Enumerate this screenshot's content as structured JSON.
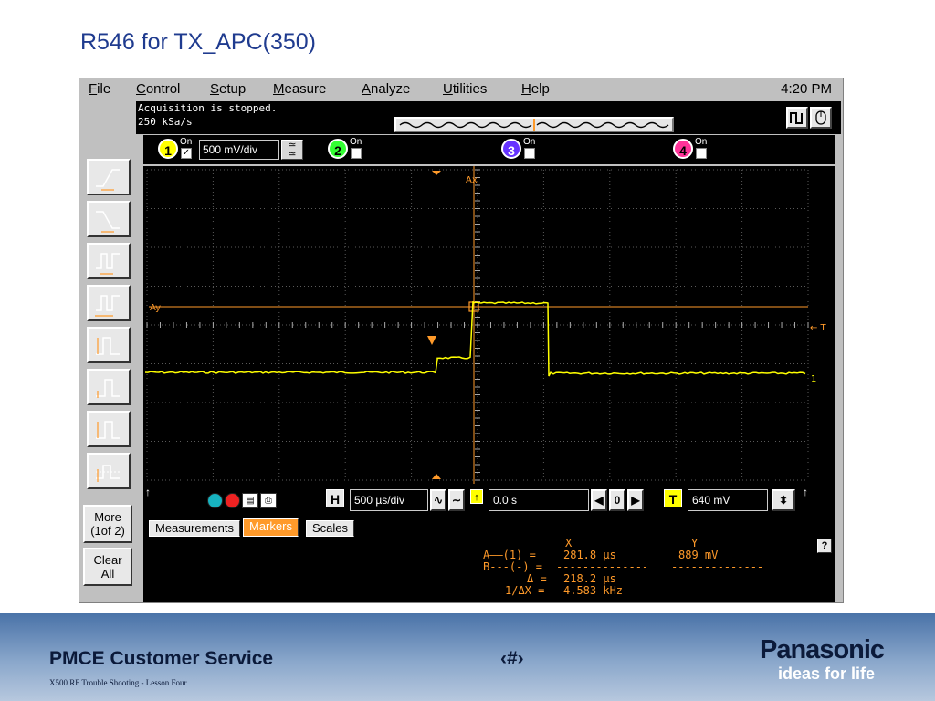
{
  "slide": {
    "title": "R546 for TX_APC(350)"
  },
  "menubar": {
    "items": [
      {
        "key": "F",
        "rest": "ile"
      },
      {
        "key": "C",
        "rest": "ontrol"
      },
      {
        "key": "S",
        "rest": "etup"
      },
      {
        "key": "M",
        "rest": "easure"
      },
      {
        "key": "A",
        "rest": "nalyze"
      },
      {
        "key": "U",
        "rest": "tilities"
      },
      {
        "key": "H",
        "rest": "elp"
      }
    ],
    "clock": "4:20 PM"
  },
  "status": {
    "line1": "Acquisition is stopped.",
    "line2": "250 kSa/s"
  },
  "channels": [
    {
      "num": "1",
      "on_label": "On",
      "checked": "✓",
      "scale": "500 mV/div",
      "color": "#ffff00"
    },
    {
      "num": "2",
      "on_label": "On",
      "checked": "",
      "color": "#33ff33"
    },
    {
      "num": "3",
      "on_label": "On",
      "checked": "",
      "color": "#6633ff"
    },
    {
      "num": "4",
      "on_label": "On",
      "checked": "",
      "color": "#ff3399"
    }
  ],
  "side_buttons": {
    "more_line1": "More",
    "more_line2": "(1of 2)",
    "clear_line1": "Clear",
    "clear_line2": "All"
  },
  "graticule_labels": {
    "ax": "Ax",
    "ay": "Ay",
    "trigger": "← T",
    "ch1": "1"
  },
  "timebar": {
    "h_label": "H",
    "timebase": "500 µs/div",
    "delay": "0.0 s",
    "delay_nav": "0",
    "t_label": "T",
    "trigger_level": "640 mV"
  },
  "tabs": {
    "measurements": "Measurements",
    "markers": "Markers",
    "scales": "Scales"
  },
  "markers": {
    "col_x": "X",
    "col_y": "Y",
    "a_label": "A——(1) =",
    "a_x": "281.8 µs",
    "a_y": "889 mV",
    "b_label": "B---(-) =",
    "b_x": "--------------",
    "b_y": "--------------",
    "delta_label": "Δ =",
    "delta_x": "218.2 µs",
    "inv_label": "1/ΔX =",
    "inv_x": "4.583 kHz",
    "help": "?"
  },
  "footer": {
    "title": "PMCE Customer Service",
    "page_num": "‹#›",
    "subtitle": "X500 RF Trouble Shooting  -  Lesson Four",
    "brand": "Panasonic",
    "tagline": "ideas for life"
  },
  "colors": {
    "trace": "#ffff00",
    "marker": "#ff9a2a",
    "grid": "#5a5a5a",
    "title_blue": "#1f3b8f"
  }
}
